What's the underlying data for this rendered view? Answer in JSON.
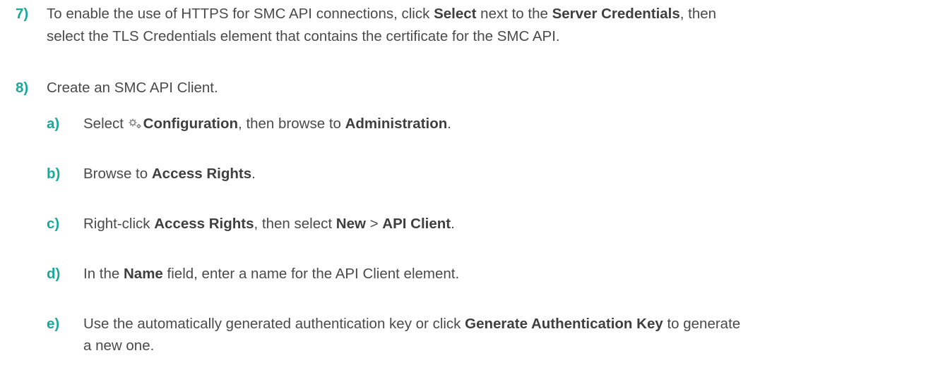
{
  "step7": {
    "num": "7)",
    "t1": "To enable the use of HTTPS for SMC API connections, click ",
    "b1": "Select",
    "t2": " next to the ",
    "b2": "Server Credentials",
    "t3": ", then",
    "line2": "select the TLS Credentials element that contains the certificate for the SMC API."
  },
  "step8": {
    "num": "8)",
    "text": "Create an SMC API Client."
  },
  "substeps": {
    "a": {
      "num": "a)",
      "t1": "Select ",
      "icon": "configuration-gear-icon",
      "b1": "Configuration",
      "t2": ", then browse to ",
      "b2": "Administration",
      "t3": "."
    },
    "b": {
      "num": "b)",
      "t1": "Browse to ",
      "b1": "Access Rights",
      "t2": "."
    },
    "c": {
      "num": "c)",
      "t1": "Right-click ",
      "b1": "Access Rights",
      "t2": ", then select ",
      "b2": "New",
      "t3": " > ",
      "b3": "API Client",
      "t4": "."
    },
    "d": {
      "num": "d)",
      "t1": "In the ",
      "b1": "Name",
      "t2": " field, enter a name for the API Client element."
    },
    "e": {
      "num": "e)",
      "t1": "Use the automatically generated authentication key or click ",
      "b1": "Generate Authentication Key",
      "t2": " to generate",
      "line2": "a new one."
    }
  },
  "colors": {
    "accent": "#18a999",
    "text": "#4a4a4a"
  }
}
